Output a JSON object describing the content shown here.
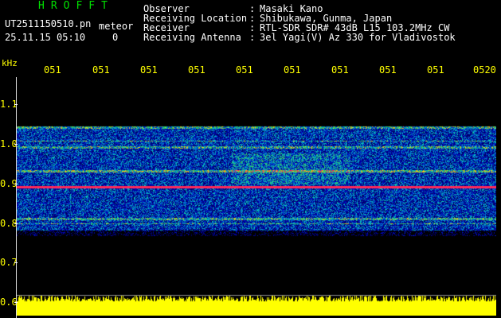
{
  "header": {
    "title": "HROFFT",
    "filename": "UT2511150510.pn",
    "meteor_label": "meteor",
    "datetime": "25.11.15 05:10",
    "count": "0"
  },
  "meta": [
    {
      "label": "Observer",
      "value": "Masaki Kano"
    },
    {
      "label": "Receiving Location",
      "value": "Shibukawa, Gunma, Japan"
    },
    {
      "label": "Receiver",
      "value": "RTL-SDR SDR# 43dB L15 103.2MHz CW"
    },
    {
      "label": "Receiving Antenna",
      "value": "3el Yagi(V) Az 330 for Vladivostok"
    }
  ],
  "axes": {
    "y_unit": "kHz",
    "y_ticks": [
      "1.1",
      "1.0",
      "0.9",
      "0.8",
      "0.7",
      "0.6"
    ],
    "x_ticks": [
      "051",
      "051",
      "051",
      "051",
      "051",
      "051",
      "051",
      "051",
      "051",
      "0520"
    ]
  },
  "colors": {
    "background": "#000000",
    "title": "#00e000",
    "labels": "#ffff00",
    "meta": "#ffffff",
    "strong_band": "#ff3060",
    "bottom_trace": "#ffff00"
  }
}
